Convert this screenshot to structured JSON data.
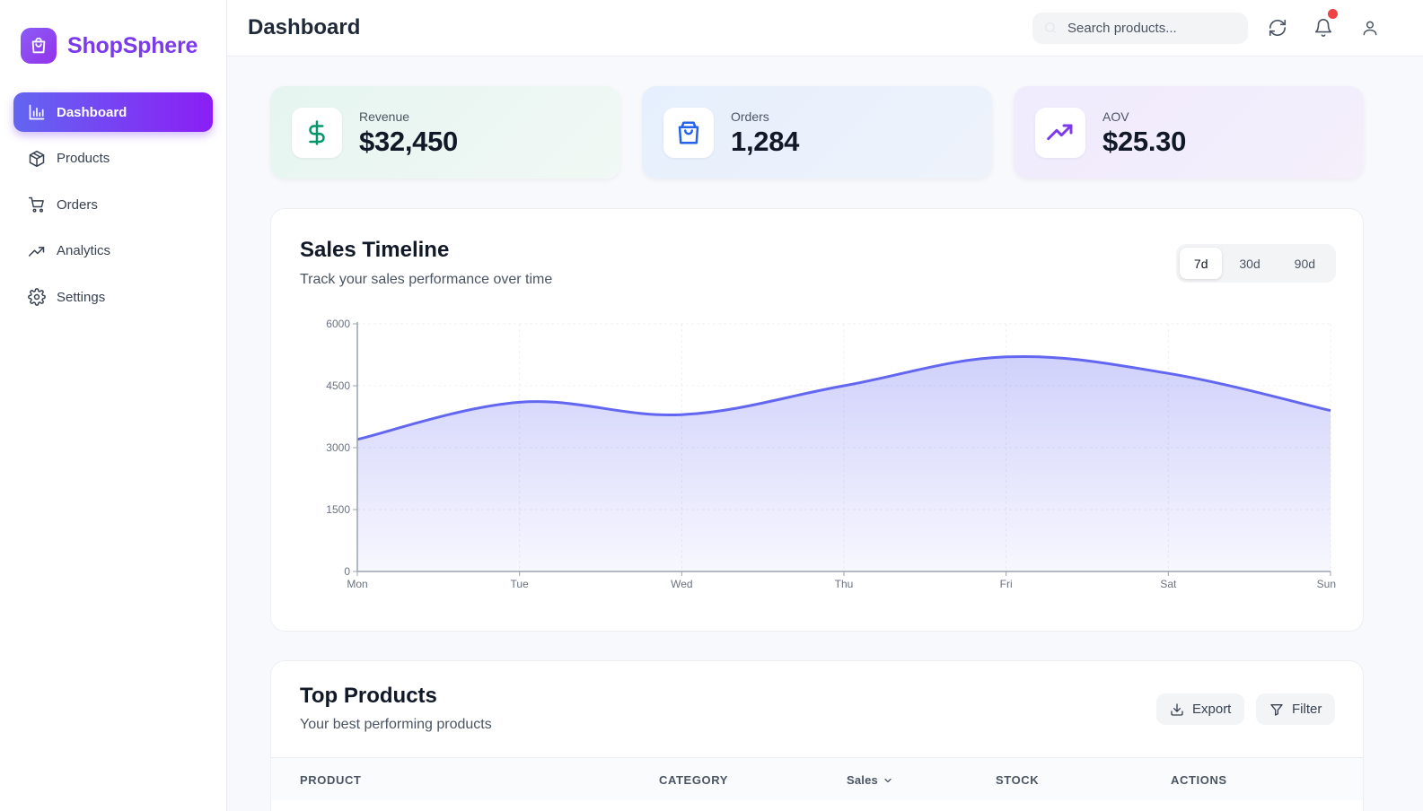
{
  "brand": {
    "name": "ShopSphere"
  },
  "sidebar": {
    "items": [
      {
        "label": "Dashboard",
        "icon": "bar-chart-icon",
        "active": true
      },
      {
        "label": "Products",
        "icon": "box-icon"
      },
      {
        "label": "Orders",
        "icon": "cart-icon"
      },
      {
        "label": "Analytics",
        "icon": "trending-up-icon"
      },
      {
        "label": "Settings",
        "icon": "gear-icon"
      }
    ]
  },
  "header": {
    "title": "Dashboard",
    "search_placeholder": "Search products...",
    "has_notification": true
  },
  "stats": [
    {
      "label": "Revenue",
      "value": "$32,450",
      "icon": "dollar-icon",
      "accent": "#059669"
    },
    {
      "label": "Orders",
      "value": "1,284",
      "icon": "shopping-bag-icon",
      "accent": "#2563eb"
    },
    {
      "label": "AOV",
      "value": "$25.30",
      "icon": "trending-up-icon",
      "accent": "#7c3aed"
    }
  ],
  "sales": {
    "title": "Sales Timeline",
    "subtitle": "Track your sales performance over time",
    "ranges": [
      "7d",
      "30d",
      "90d"
    ],
    "selected_range": "7d"
  },
  "chart_data": {
    "type": "area",
    "categories": [
      "Mon",
      "Tue",
      "Wed",
      "Thu",
      "Fri",
      "Sat",
      "Sun"
    ],
    "values": [
      3200,
      4100,
      3800,
      4500,
      5200,
      4800,
      3900
    ],
    "ylim": [
      0,
      6000
    ],
    "yticks": [
      0,
      1500,
      3000,
      4500,
      6000
    ],
    "grid": true,
    "color": "#6366f1"
  },
  "top_products": {
    "title": "Top Products",
    "subtitle": "Your best performing products",
    "export_label": "Export",
    "filter_label": "Filter",
    "columns": [
      "Product",
      "Category",
      "Sales",
      "Stock",
      "Actions"
    ]
  }
}
